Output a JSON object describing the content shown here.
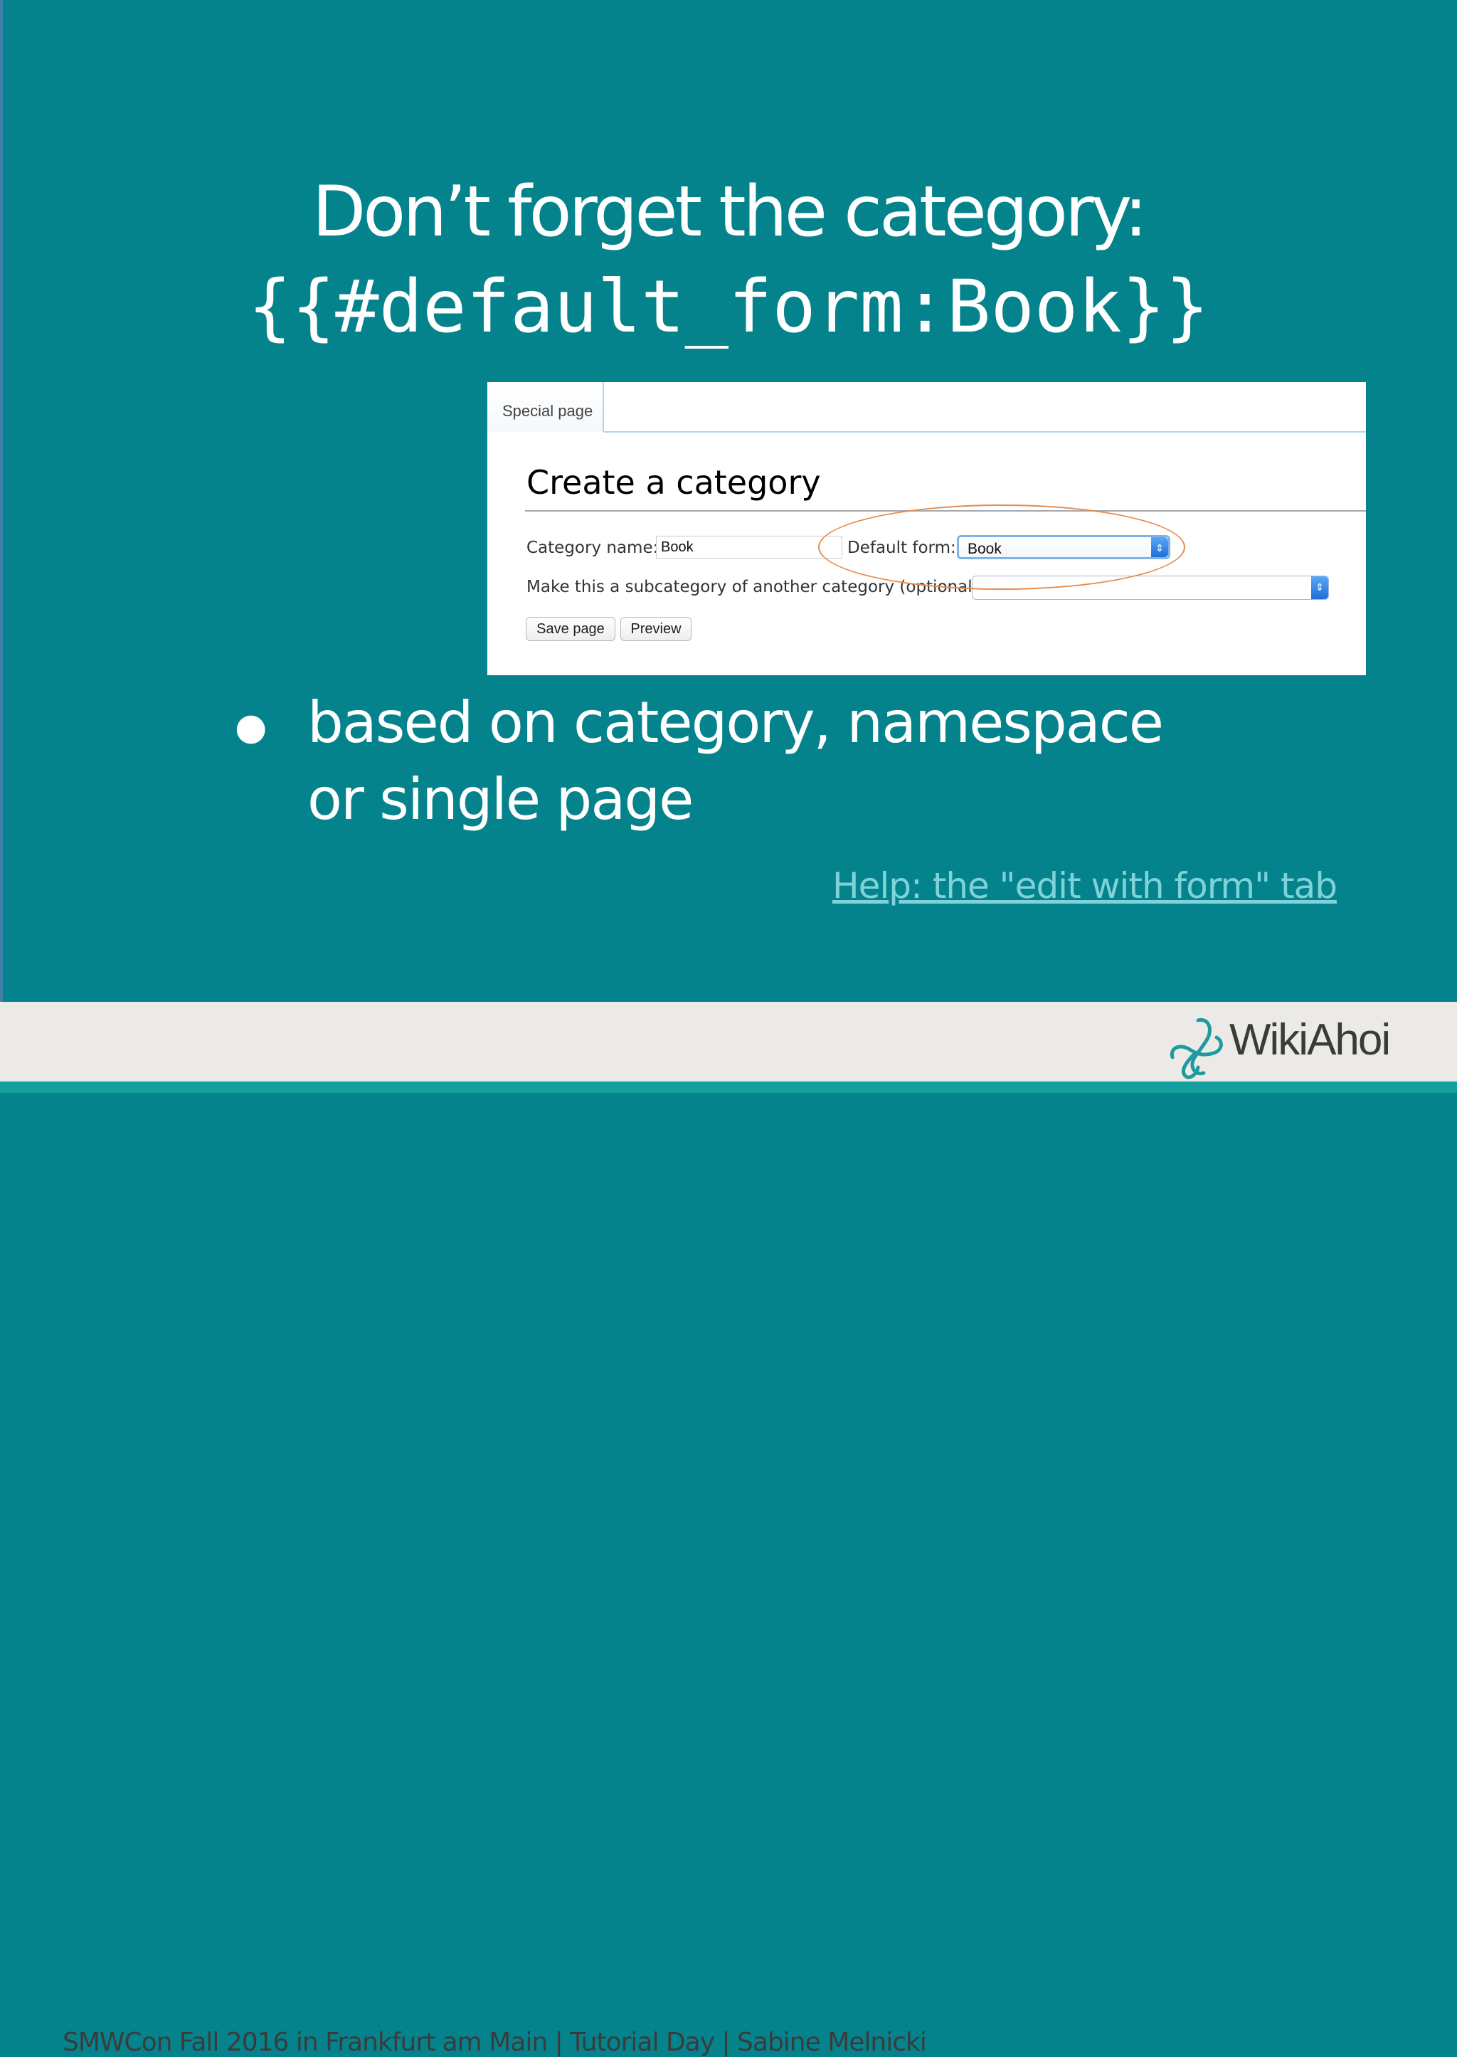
{
  "slide": {
    "title": "Don’t forget the category:",
    "code": "{{#default_form:Book}}",
    "bullet": "based on category, namespace or single page",
    "help_link": "Help: the \"edit with form\" tab"
  },
  "screenshot": {
    "tab": "Special page",
    "heading": "Create a category",
    "category_name_label": "Category name:",
    "category_name_value": "Book",
    "default_form_label": "Default form:",
    "default_form_value": "Book",
    "subcategory_label": "Make this a subcategory of another category (optional):",
    "subcategory_value": "",
    "save_button": "Save page",
    "preview_button": "Preview"
  },
  "footer": {
    "text": "SMWCon Fall 2016 in Frankfurt am Main | Tutorial Day | Sabine  Melnicki",
    "logo": "WikiAhoi"
  },
  "colors": {
    "background": "#05838d",
    "link": "#7fd3d8",
    "highlight": "#e58c4a",
    "footer_bar": "#15a0a0"
  }
}
